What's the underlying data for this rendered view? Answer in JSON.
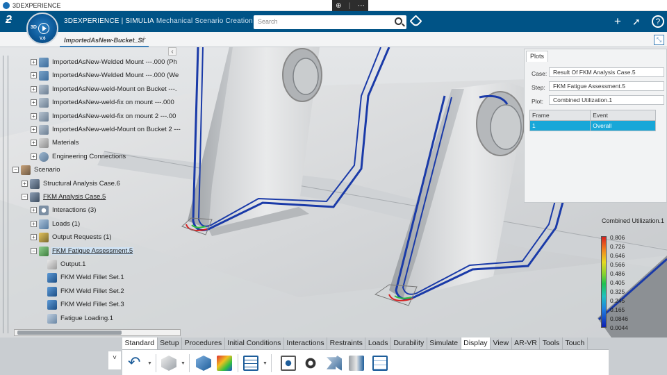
{
  "os": {
    "title": "3DEXPERIENCE",
    "tool_zoom_icon": "zoom-icon",
    "tool_more": "⋯"
  },
  "header": {
    "compass_label": "3D",
    "compass_version": "V.6",
    "brand_prefix": "3DEXPERIENCE",
    "brand_sep": " | ",
    "brand_name": "SIMULIA",
    "app_name": "Mechanical Scenario Creation",
    "search_placeholder": "Search",
    "add_icon": "+",
    "share_icon": "share-icon",
    "help_icon": "?"
  },
  "tabs": {
    "active_tab": "ImportedAsNew-Bucket_St",
    "add_tab": "+"
  },
  "tree": {
    "collapse_glyph": "‹",
    "nodes": [
      {
        "label": "ImportedAsNew-Welded Mount ---.000 (Ph",
        "icon": "part-icon",
        "depth": 3
      },
      {
        "label": "ImportedAsNew-Welded Mount ---.000 (We",
        "icon": "part-icon",
        "depth": 3
      },
      {
        "label": "ImportedAsNew-weld-Mount on Bucket ---.",
        "icon": "weld-icon",
        "depth": 3
      },
      {
        "label": "ImportedAsNew-weld-fix on mount ---.000",
        "icon": "weld-icon",
        "depth": 3
      },
      {
        "label": "ImportedAsNew-weld-fix on mount 2 ---.00",
        "icon": "weld-icon",
        "depth": 3
      },
      {
        "label": "ImportedAsNew-weld-Mount on Bucket 2 ---",
        "icon": "weld-icon",
        "depth": 3
      },
      {
        "label": "Materials",
        "icon": "materials-icon",
        "depth": 3
      },
      {
        "label": "Engineering Connections",
        "icon": "engineering-connections-icon",
        "depth": 3
      },
      {
        "label": "Scenario",
        "icon": "scenario-icon",
        "depth": 1
      },
      {
        "label": "Structural Analysis Case.6",
        "icon": "analysis-case-icon",
        "depth": 2
      },
      {
        "label": "FKM Analysis Case.5",
        "icon": "fkm-case-icon",
        "depth": 2
      },
      {
        "label": "Interactions (3)",
        "icon": "interactions-icon",
        "depth": 3
      },
      {
        "label": "Loads (1)",
        "icon": "loads-icon",
        "depth": 3
      },
      {
        "label": "Output Requests (1)",
        "icon": "output-requests-icon",
        "depth": 3
      },
      {
        "label": "FKM Fatigue Assessment.5",
        "icon": "fatigue-icon",
        "depth": 3
      },
      {
        "label": "Output.1",
        "icon": "output-icon",
        "depth": 4
      },
      {
        "label": "FKM Weld Fillet Set.1",
        "icon": "weld-fillet-icon",
        "depth": 4
      },
      {
        "label": "FKM Weld Fillet Set.2",
        "icon": "weld-fillet-icon",
        "depth": 4
      },
      {
        "label": "FKM Weld Fillet Set.3",
        "icon": "weld-fillet-icon",
        "depth": 4
      },
      {
        "label": "Fatigue Loading.1",
        "icon": "fatigue-loading-icon",
        "depth": 4
      }
    ]
  },
  "plots": {
    "tab_label": "Plots",
    "case_label": "Case:",
    "case_value": "Result Of FKM Analysis Case.5",
    "step_label": "Step:",
    "step_value": "FKM Fatigue Assessment.5",
    "plot_label": "Plot:",
    "plot_value": "Combined Utilization.1",
    "table_headers": [
      "Frame",
      "Event"
    ],
    "table_rows": [
      [
        "1",
        "Overall"
      ]
    ]
  },
  "legend": {
    "title": "Combined Utilization.1",
    "values": [
      "0.806",
      "0.726",
      "0.646",
      "0.566",
      "0.486",
      "0.405",
      "0.325",
      "0.245",
      "0.165",
      "0.0846",
      "0.0044"
    ],
    "colors": {
      "max": "#d62020",
      "mid": "#20c050",
      "min": "#1020b0"
    }
  },
  "action_bar": {
    "sections": [
      "Standard",
      "Setup",
      "Procedures",
      "Initial Conditions",
      "Interactions",
      "Restraints",
      "Loads",
      "Durability",
      "Simulate",
      "Display",
      "View",
      "AR-VR",
      "Tools",
      "Touch"
    ],
    "active_section": "Display",
    "collapse_glyph": "˅",
    "tool_icons": [
      "undo-icon",
      "display-shape-icon",
      "shaded-icon",
      "results-plot-icon",
      "table-icon",
      "eye-icon",
      "visibility-icon",
      "explode-icon",
      "section-icon",
      "info-icon"
    ]
  },
  "colors": {
    "header": "#005386",
    "accent": "#18a7d8",
    "weld_line": "#1a3aa8"
  }
}
